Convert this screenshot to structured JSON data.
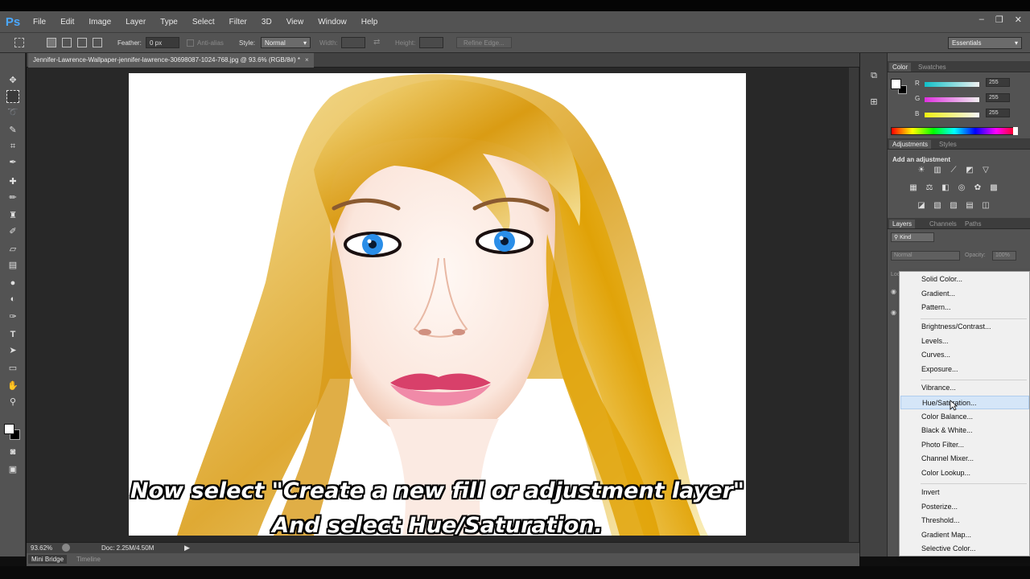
{
  "app": {
    "logo": "Ps",
    "menu": [
      "File",
      "Edit",
      "Image",
      "Layer",
      "Type",
      "Select",
      "Filter",
      "3D",
      "View",
      "Window",
      "Help"
    ],
    "window_controls": [
      "–",
      "❐",
      "✕"
    ]
  },
  "options_bar": {
    "feather_label": "Feather:",
    "feather_value": "0 px",
    "antialias_label": "Anti-alias",
    "style_label": "Style:",
    "style_value": "Normal",
    "width_label": "Width:",
    "height_label": "Height:",
    "refine_edge": "Refine Edge...",
    "workspace": "Essentials"
  },
  "document": {
    "tab_title": "Jennifer-Lawrence-Wallpaper-jennifer-lawrence-30698087-1024-768.jpg @ 93.6% (RGB/8#) *",
    "close": "×",
    "zoom": "93.62%",
    "doc_info": "Doc: 2.25M/4.50M",
    "caption_line1": "Now select \"Create a new fill or adjustment layer\"",
    "caption_line2": "And select Hue/Saturation."
  },
  "bottom_tabs": [
    "Mini Bridge",
    "Timeline"
  ],
  "color_panel": {
    "tabs": [
      "Color",
      "Swatches"
    ],
    "channels": [
      {
        "label": "R",
        "value": "255",
        "color": "#29e0e8"
      },
      {
        "label": "G",
        "value": "255",
        "color": "#e040e0"
      },
      {
        "label": "B",
        "value": "255",
        "color": "#f0f020"
      }
    ]
  },
  "adjustments_panel": {
    "tabs": [
      "Adjustments",
      "Styles"
    ],
    "title": "Add an adjustment"
  },
  "layers_panel": {
    "tabs": [
      "Layers",
      "Channels",
      "Paths"
    ],
    "kind": "Kind",
    "blend_mode": "Normal",
    "opacity_label": "Opacity:",
    "opacity_value": "100%",
    "lock_label": "Lock"
  },
  "dropdown": {
    "items": [
      "Solid Color...",
      "Gradient...",
      "Pattern...",
      "Brightness/Contrast...",
      "Levels...",
      "Curves...",
      "Exposure...",
      "Vibrance...",
      "Hue/Saturation...",
      "Color Balance...",
      "Black & White...",
      "Photo Filter...",
      "Channel Mixer...",
      "Color Lookup...",
      "Invert",
      "Posterize...",
      "Threshold...",
      "Gradient Map...",
      "Selective Color..."
    ],
    "hovered": "Hue/Saturation..."
  }
}
